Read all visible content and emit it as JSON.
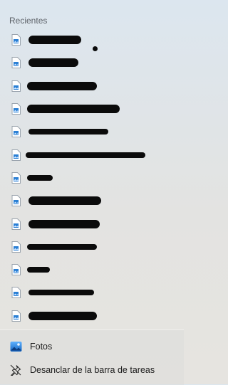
{
  "jumplist": {
    "recent_header": "Recientes",
    "recent_items_count": 13,
    "actions": [
      {
        "label": "Fotos",
        "icon": "photos-app-icon"
      },
      {
        "label": "Desanclar de la barra de tareas",
        "icon": "unpin-icon"
      }
    ]
  }
}
